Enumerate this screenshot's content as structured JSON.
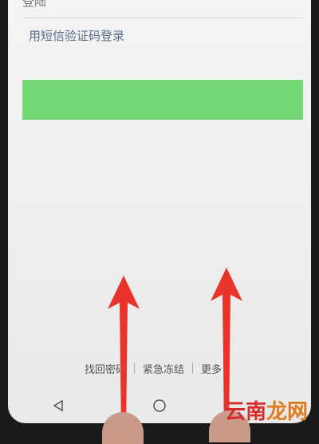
{
  "login": {
    "sms_login_label": "用短信验证码登录",
    "top_cut_label": "登陆",
    "login_button_color": "#74d776"
  },
  "footer": {
    "links": [
      "找回密码",
      "紧急冻结",
      "更多"
    ]
  },
  "navbar": {
    "back_icon": "back-triangle-icon",
    "home_icon": "home-circle-icon"
  },
  "watermark": {
    "part1": "云南",
    "part2": "龙网"
  },
  "colors": {
    "accent_green": "#74d776",
    "arrow_red": "#e8342a",
    "link_text": "#5a6b86"
  }
}
